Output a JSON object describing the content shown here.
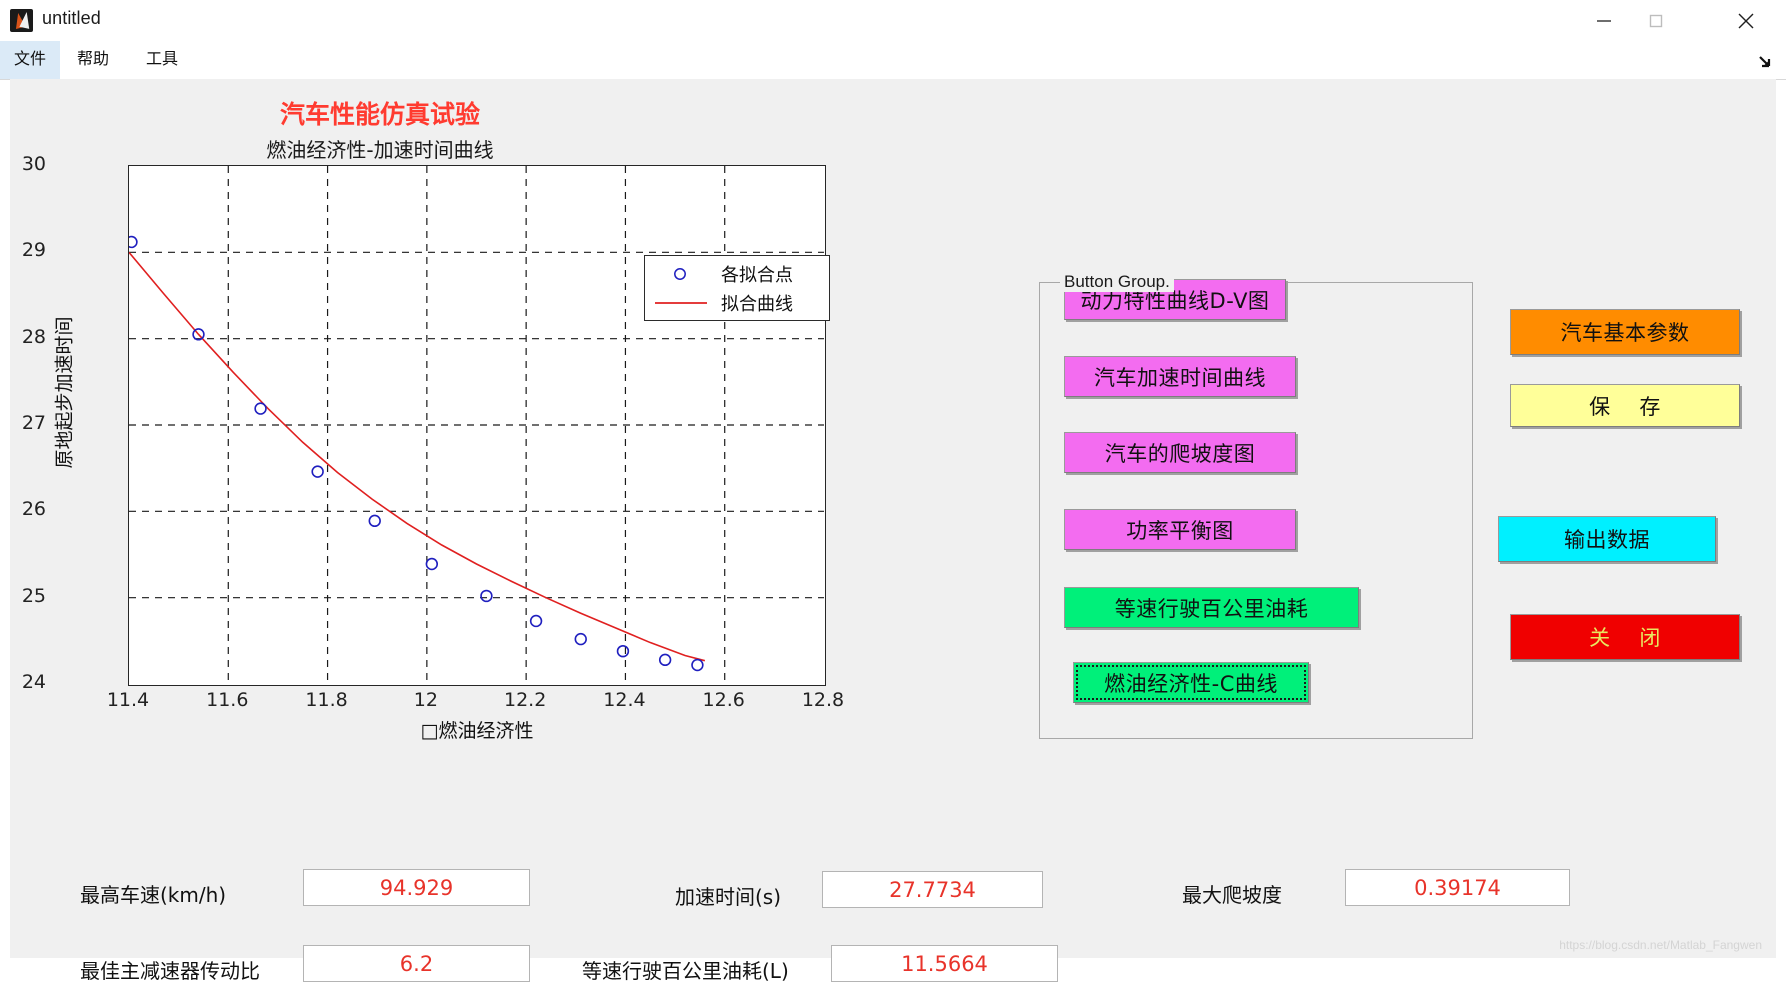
{
  "window": {
    "title": "untitled",
    "icon": "matlab-icon",
    "controls": [
      {
        "name": "minimize",
        "glyph": "minimize-icon"
      },
      {
        "name": "maximize",
        "glyph": "maximize-icon"
      },
      {
        "name": "close",
        "glyph": "close-icon"
      }
    ]
  },
  "menu": {
    "items": [
      {
        "label": "文件",
        "selected": true
      },
      {
        "label": "帮助",
        "selected": false
      },
      {
        "label": "工具",
        "selected": false
      }
    ],
    "expand_icon": "expand-arrow-icon"
  },
  "headings": {
    "main_title": "汽车性能仿真试验",
    "main_title_color": "#ff3b30",
    "sub_title": "燃油经济性-加速时间曲线"
  },
  "chart_data": {
    "type": "scatter",
    "title": "燃油经济性-加速时间曲线",
    "xlabel": "燃油经济性",
    "xlabel_prefix": "□",
    "ylabel": "原地起步加速时间",
    "xlim": [
      11.4,
      12.8
    ],
    "ylim": [
      24,
      30
    ],
    "xticks": [
      "11.4",
      "11.6",
      "11.8",
      "12",
      "12.2",
      "12.4",
      "12.6",
      "12.8"
    ],
    "yticks": [
      "24",
      "25",
      "26",
      "27",
      "28",
      "29",
      "30"
    ],
    "grid": true,
    "grid_style": "dashed",
    "legend_position": "top-right",
    "series": [
      {
        "name": "各拟合点",
        "type": "scatter",
        "marker": "circle",
        "color": "#1f1fbf",
        "x": [
          11.405,
          11.54,
          11.665,
          11.78,
          11.895,
          12.01,
          12.12,
          12.22,
          12.31,
          12.395,
          12.48,
          12.545
        ],
        "y": [
          29.12,
          28.05,
          27.19,
          26.46,
          25.89,
          25.39,
          25.02,
          24.73,
          24.52,
          24.38,
          24.28,
          24.22
        ]
      },
      {
        "name": "拟合曲线",
        "type": "line",
        "color": "#e02020",
        "x": [
          11.4,
          11.47,
          11.54,
          11.61,
          11.68,
          11.75,
          11.82,
          11.89,
          11.96,
          12.03,
          12.1,
          12.17,
          12.24,
          12.31,
          12.38,
          12.45,
          12.52,
          12.56
        ],
        "y": [
          29.0,
          28.52,
          28.05,
          27.61,
          27.19,
          26.8,
          26.45,
          26.14,
          25.86,
          25.61,
          25.39,
          25.19,
          25.0,
          24.82,
          24.65,
          24.48,
          24.33,
          24.27
        ]
      }
    ]
  },
  "button_group": {
    "panel_title": "Button Group.",
    "buttons": [
      {
        "label": "动力特性曲线D-V图",
        "color": "#f36cf0",
        "focused": false
      },
      {
        "label": "汽车加速时间曲线",
        "color": "#f36cf0",
        "focused": false
      },
      {
        "label": "汽车的爬坡度图",
        "color": "#f36cf0",
        "focused": false
      },
      {
        "label": "功率平衡图",
        "color": "#f36cf0",
        "focused": false
      },
      {
        "label": "等速行驶百公里油耗",
        "color": "#00f07a",
        "focused": false
      },
      {
        "label": "燃油经济性-C曲线",
        "color": "#00f07a",
        "focused": true
      }
    ]
  },
  "action_buttons": [
    {
      "label": "汽车基本参数",
      "bg": "#ff8c00",
      "fg": "#111111"
    },
    {
      "label": "保    存",
      "bg": "#ffff99",
      "fg": "#111111"
    },
    {
      "label": "输出数据",
      "bg": "#00f0ff",
      "fg": "#111111"
    },
    {
      "label": "关    闭",
      "bg": "#f00000",
      "fg": "#e8e860"
    }
  ],
  "fields": [
    {
      "label": "最高车速(km/h)",
      "value": "94.929"
    },
    {
      "label": "加速时间(s)",
      "value": "27.7734"
    },
    {
      "label": "最大爬坡度",
      "value": "0.39174"
    },
    {
      "label": "最佳主减速器传动比",
      "value": "6.2"
    },
    {
      "label": "等速行驶百公里油耗(L)",
      "value": "11.5664"
    }
  ],
  "watermark": "https://blog.csdn.net/Matlab_Fangwen"
}
